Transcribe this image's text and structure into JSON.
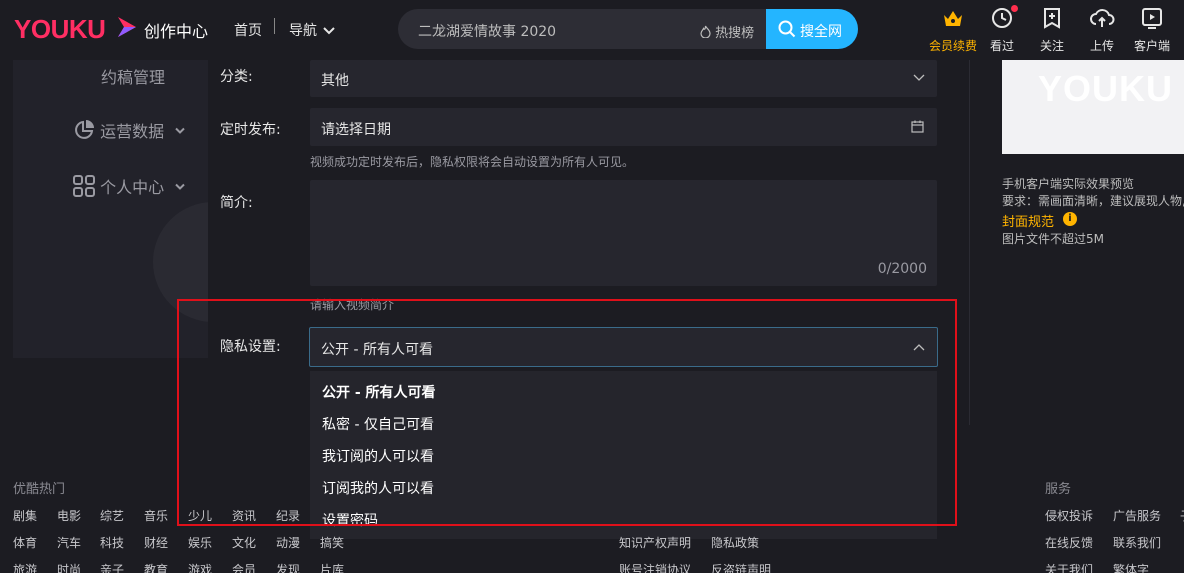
{
  "header": {
    "logo": "YOUKU",
    "logo_sub": "创作中心",
    "nav_home": "首页",
    "nav_guide": "导航",
    "search_value": "二龙湖爱情故事 2020",
    "hot_search": "热搜榜",
    "search_button": "搜全网",
    "icons": [
      {
        "label": "会员续费",
        "icon": "crown-icon",
        "color": "#ffb400"
      },
      {
        "label": "看过",
        "icon": "clock-icon"
      },
      {
        "label": "关注",
        "icon": "bookmark-plus-icon"
      },
      {
        "label": "上传",
        "icon": "cloud-upload-icon"
      },
      {
        "label": "客户端",
        "icon": "play-screen-icon"
      }
    ]
  },
  "sidebar": {
    "items": [
      {
        "label": "约稿管理"
      },
      {
        "label": "运营数据",
        "icon": "pie-chart-icon"
      },
      {
        "label": "个人中心",
        "icon": "grid-icon"
      }
    ]
  },
  "form": {
    "category_label": "分类:",
    "category_value": "其他",
    "schedule_label": "定时发布:",
    "schedule_placeholder": "请选择日期",
    "schedule_hint": "视频成功定时发布后，隐私权限将会自动设置为所有人可见。",
    "intro_label": "简介:",
    "intro_counter": "0/2000",
    "intro_hint": "请输入视频简介",
    "privacy_label": "隐私设置:",
    "privacy_value": "公开 - 所有人可看",
    "privacy_options": [
      "公开 - 所有人可看",
      "私密 - 仅自己可看",
      "我订阅的人可以看",
      "订阅我的人可以看",
      "设置密码"
    ]
  },
  "right_panel": {
    "preview_logo": "YOUKU",
    "preview_caption": "手机客户端实际效果预览",
    "requirement": "要求：需画面清晰，建议展现人物,",
    "cover_spec": "封面规范",
    "file_limit": "图片文件不超过5M"
  },
  "footer": {
    "hot_title": "优酷热门",
    "row1": [
      "剧集",
      "电影",
      "综艺",
      "音乐",
      "少儿",
      "资讯",
      "纪录"
    ],
    "row2": [
      "体育",
      "汽车",
      "科技",
      "财经",
      "娱乐",
      "文化",
      "动漫",
      "搞笑"
    ],
    "row3": [
      "旅游",
      "时尚",
      "亲子",
      "教育",
      "游戏",
      "会员",
      "发现",
      "片库"
    ],
    "mid_row2": [
      "知识产权声明",
      "隐私政策"
    ],
    "mid_row3": [
      "账号注销协议",
      "反盗链声明"
    ],
    "service_title": "服务",
    "service_row1": [
      "侵权投诉",
      "广告服务",
      "子"
    ],
    "service_row2": [
      "在线反馈",
      "联系我们"
    ],
    "service_row3": [
      "关于我们",
      "繁体字"
    ]
  },
  "colors": {
    "accent_blue": "#24b5ff",
    "brand_pink": "#ff2e63",
    "vip_gold": "#ffb400",
    "highlight_red": "#e0101a"
  }
}
